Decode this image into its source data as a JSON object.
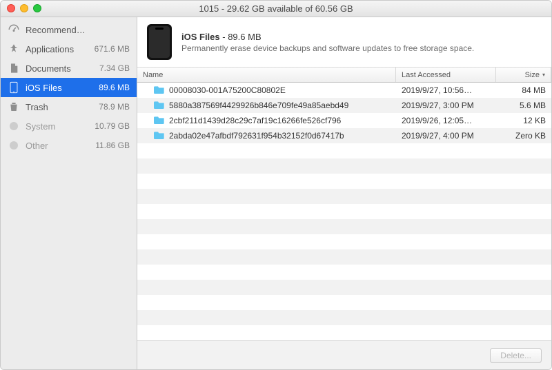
{
  "window": {
    "title": "1015 - 29.62 GB available of 60.56 GB"
  },
  "sidebar": {
    "items": [
      {
        "label": "Recommendations",
        "size": ""
      },
      {
        "label": "Applications",
        "size": "671.6 MB"
      },
      {
        "label": "Documents",
        "size": "7.34 GB"
      },
      {
        "label": "iOS Files",
        "size": "89.6 MB"
      },
      {
        "label": "Trash",
        "size": "78.9 MB"
      },
      {
        "label": "System",
        "size": "10.79 GB"
      },
      {
        "label": "Other",
        "size": "11.86 GB"
      }
    ]
  },
  "header": {
    "title": "iOS Files",
    "size": "89.6 MB",
    "separator": " - ",
    "subtitle": "Permanently erase device backups and software updates to free storage space."
  },
  "table": {
    "columns": {
      "name": "Name",
      "date": "Last Accessed",
      "size": "Size"
    },
    "rows": [
      {
        "name": "00008030-001A75200C80802E",
        "date": "2019/9/27, 10:56…",
        "size": "84 MB"
      },
      {
        "name": "5880a387569f4429926b846e709fe49a85aebd49",
        "date": "2019/9/27, 3:00 PM",
        "size": "5.6 MB"
      },
      {
        "name": "2cbf211d1439d28c29c7af19c16266fe526cf796",
        "date": "2019/9/26, 12:05…",
        "size": "12 KB"
      },
      {
        "name": "2abda02e47afbdf792631f954b32152f0d67417b",
        "date": "2019/9/27, 4:00 PM",
        "size": "Zero KB"
      }
    ]
  },
  "footer": {
    "delete_label": "Delete..."
  }
}
